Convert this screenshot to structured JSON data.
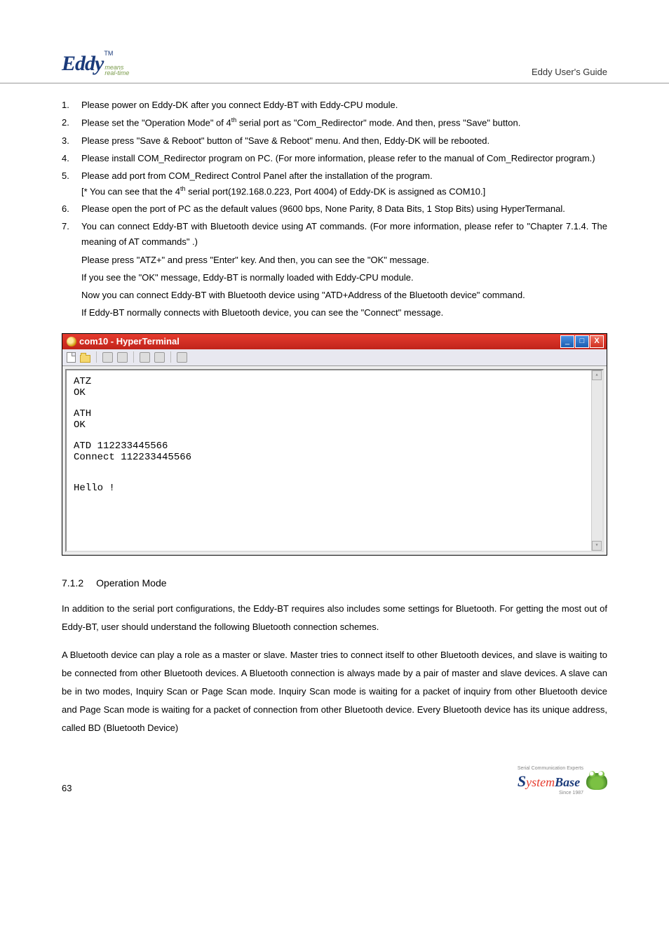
{
  "header": {
    "logo_text": "Eddy",
    "logo_tm": "TM",
    "logo_sub1": "means",
    "logo_sub2": "real-time",
    "title": "Eddy User's Guide"
  },
  "steps": {
    "s1": "Please power on Eddy-DK after you connect Eddy-BT with Eddy-CPU module.",
    "s2a": "Please set the  \"Operation Mode\"  of 4",
    "s2b": " serial port as  \"Com_Redirector\"  mode. And then, press  \"Save\" button.",
    "s3": "Please press  \"Save & Reboot\"  button of  \"Save & Reboot\"  menu. And then, Eddy-DK will be rebooted.",
    "s4": "Please install COM_Redirector program on PC. (For more information, please refer to the manual of Com_Redirector program.)",
    "s5a": "Please add port from COM_Redirect Control Panel after the installation of the program.",
    "s5b_pre": "[* You can see that the 4",
    "s5b_post": " serial port(192.168.0.223, Port 4004) of Eddy-DK is assigned as COM10.]",
    "s6": "Please open the port of PC as the default values (9600 bps, None Parity, 8 Data Bits, 1 Stop Bits) using HyperTermanal.",
    "s7a": "You can connect Eddy-BT with Bluetooth device using AT commands. (For more information, please refer to \"Chapter 7.1.4. The meaning of AT commands\" .)",
    "s7b": "Please press  \"ATZ+\"  and press  \"Enter\"  key. And then, you can see the  \"OK\"  message.",
    "s7c": "If you see the  \"OK\"  message, Eddy-BT is normally loaded with Eddy-CPU module.",
    "s7d": "Now you can connect Eddy-BT with Bluetooth device using  \"ATD+Address of the Bluetooth device\" command.",
    "s7e": "If Eddy-BT normally connects with Bluetooth device, you can see the  \"Connect\"  message.",
    "th_sup": "th"
  },
  "terminal": {
    "title": "com10 - HyperTerminal",
    "lines": [
      "ATZ",
      "OK",
      "",
      "ATH",
      "OK",
      "",
      "ATD 112233445566",
      "Connect 112233445566",
      "",
      "",
      "Hello !"
    ],
    "min": "_",
    "max": "□",
    "close": "X"
  },
  "section": {
    "num": "7.1.2",
    "title": "Operation Mode",
    "p1": "In addition to the serial port configurations, the Eddy-BT requires also includes some settings for Bluetooth. For getting the most out of Eddy-BT, user should understand the following Bluetooth connection schemes.",
    "p2": "A Bluetooth device can play a role as a master or slave. Master tries to connect itself to other Bluetooth devices, and slave is waiting to be connected from other Bluetooth devices. A Bluetooth connection is always made by a pair of master and slave devices. A slave can be in two modes, Inquiry Scan or Page Scan mode. Inquiry Scan mode is waiting for a packet of inquiry from other Bluetooth device and Page Scan mode is waiting for a packet of connection from other Bluetooth device. Every Bluetooth device has its unique address, called BD (Bluetooth Device)"
  },
  "footer": {
    "page": "63",
    "sb_s": "S",
    "sb_ystem": "ystem",
    "sb_base": "Base",
    "sb_sub1": "Serial Communication Experts",
    "sb_sub2": "Since 1987"
  }
}
